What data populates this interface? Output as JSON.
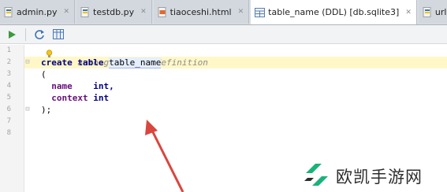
{
  "tabs": [
    {
      "label": "admin.py",
      "icon": "python-file-icon"
    },
    {
      "label": "testdb.py",
      "icon": "python-file-icon"
    },
    {
      "label": "tiaoceshi.html",
      "icon": "html-file-icon"
    },
    {
      "label": "table_name (DDL) [db.sqlite3]",
      "icon": "table-ddl-icon",
      "active": true
    },
    {
      "label": "urls.p",
      "icon": "python-file-icon"
    }
  ],
  "toolbar": {
    "run_icon": "run-icon",
    "refresh_icon": "refresh-icon",
    "table_icon": "table-view-icon"
  },
  "editor": {
    "line_numbers": [
      "1",
      "2",
      "3",
      "4",
      "5",
      "6",
      "7",
      "8"
    ],
    "comment": "-- auto-generated definition",
    "line2_kw": "create table ",
    "line2_name": "table_name",
    "line3": "(",
    "line4_field": "name",
    "line4_type": "int,",
    "line5_field": "context",
    "line5_type": "int",
    "line6": ");"
  },
  "watermark": {
    "text": "欧凯手游网"
  },
  "colors": {
    "arrow": "#d9463e",
    "watermark_icon": "#19b37a"
  }
}
